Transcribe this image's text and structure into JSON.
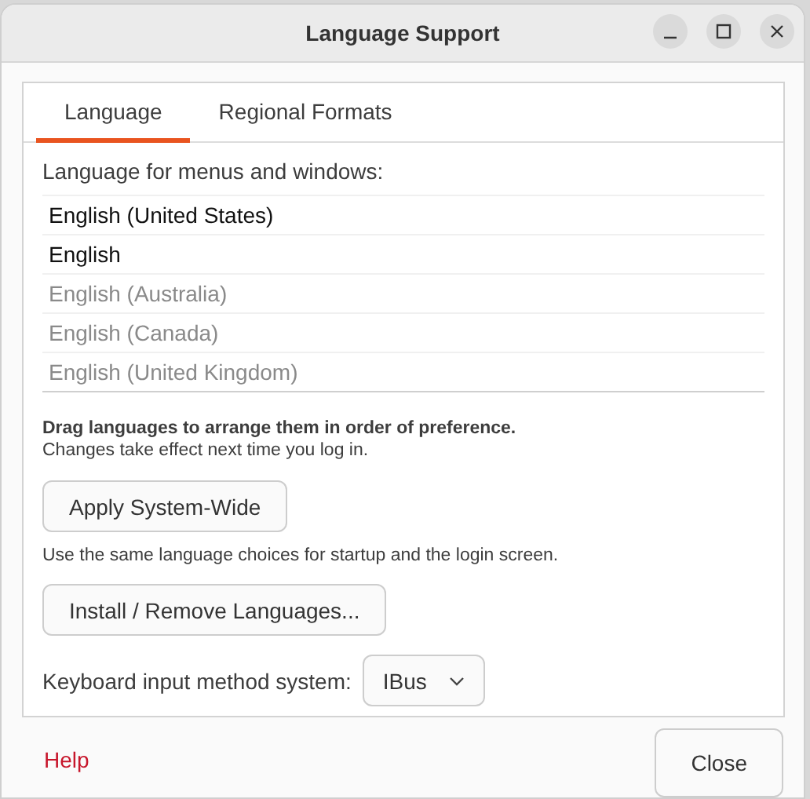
{
  "window": {
    "title": "Language Support"
  },
  "tabs": [
    {
      "label": "Language",
      "selected": true
    },
    {
      "label": "Regional Formats",
      "selected": false
    }
  ],
  "language_list": {
    "label": "Language for menus and windows:",
    "items": [
      {
        "name": "English (United States)",
        "disabled": false
      },
      {
        "name": "English",
        "disabled": false
      },
      {
        "name": "English (Australia)",
        "disabled": true
      },
      {
        "name": "English (Canada)",
        "disabled": true
      },
      {
        "name": "English (United Kingdom)",
        "disabled": true
      }
    ]
  },
  "hint": {
    "bold": "Drag languages to arrange them in order of preference.",
    "text": "Changes take effect next time you log in."
  },
  "apply_button": "Apply System-Wide",
  "apply_note": "Use the same language choices for startup and the login screen.",
  "install_button": "Install / Remove Languages...",
  "input_method": {
    "label": "Keyboard input method system:",
    "value": "IBus"
  },
  "help_button": "Help",
  "close_button": "Close"
}
